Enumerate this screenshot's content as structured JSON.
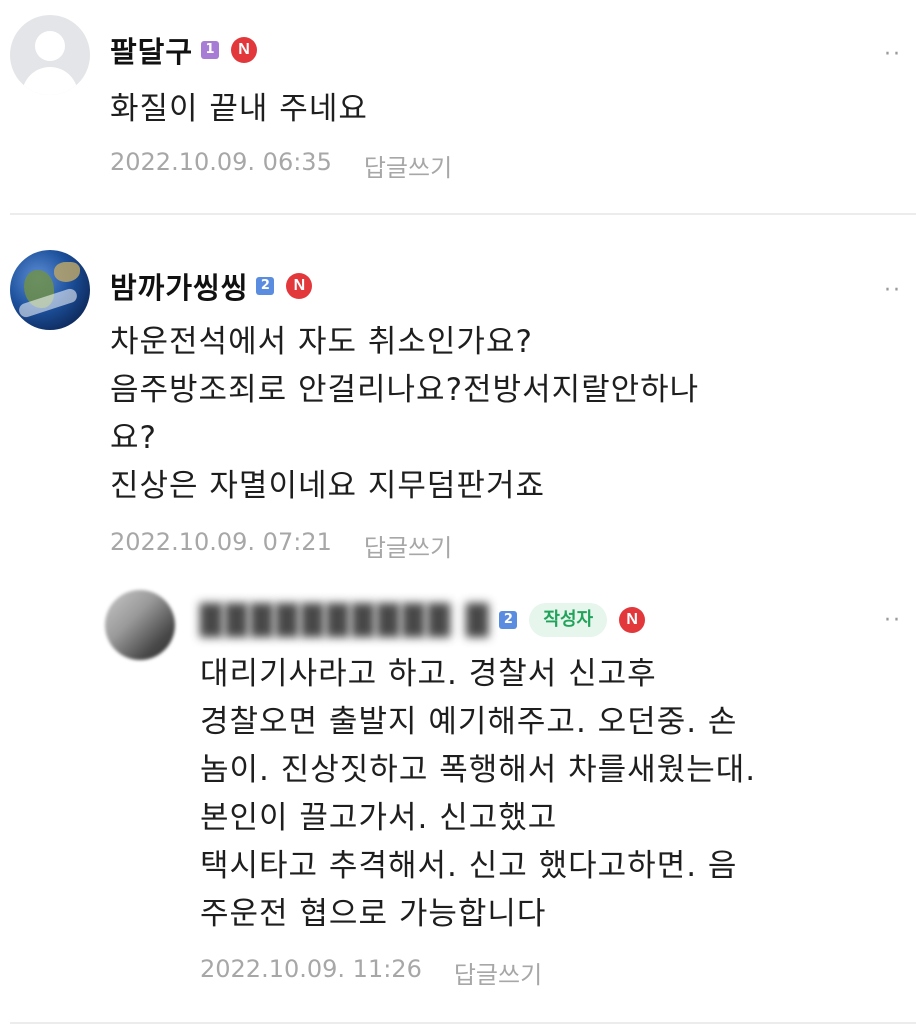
{
  "comments": [
    {
      "nickname": "팔달구",
      "level": "1",
      "level_color": "#a77cd4",
      "new_badge": "N",
      "text": "화질이 끝내 주네요",
      "date": "2022.10.09. 06:35",
      "reply_label": "답글쓰기"
    },
    {
      "nickname": "밤까가씽씽",
      "level": "2",
      "level_color": "#5a8de0",
      "new_badge": "N",
      "text": "차운전석에서 자도 취소인가요?\n음주방조죄로 안걸리나요?전방서지랄안하나\n요?\n진상은 자멸이네요 지무덤판거죠",
      "date": "2022.10.09. 07:21",
      "reply_label": "답글쓰기"
    },
    {
      "nickname": "██████████ █",
      "level": "2",
      "level_color": "#5a8de0",
      "author_badge": "작성자",
      "new_badge": "N",
      "text": "대리기사라고 하고. 경찰서 신고후\n경찰오면 출발지 예기해주고. 오던중. 손\n놈이. 진상짓하고 폭행해서 차를새웠는대.\n본인이 끌고가서. 신고했고\n택시타고 추격해서. 신고 했다고하면. 음\n주운전 협으로 가능합니다",
      "date": "2022.10.09. 11:26",
      "reply_label": "답글쓰기"
    }
  ],
  "more_icon": "more-dots-icon",
  "colors": {
    "new_badge": "#e2383b",
    "author_badge_bg": "#e6f6ec",
    "author_badge_text": "#22a35b",
    "meta_text": "#a7a7a7"
  }
}
